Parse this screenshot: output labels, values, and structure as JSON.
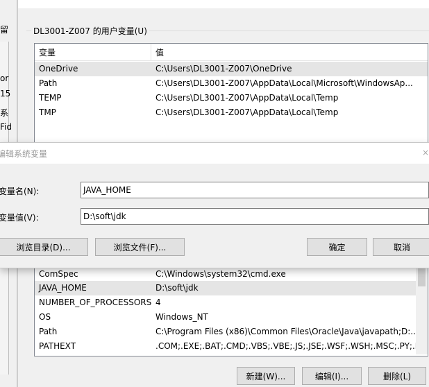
{
  "background_window": {
    "left_text_fragments": [
      "留",
      "or",
      "15",
      "系",
      "Fid"
    ]
  },
  "user_vars": {
    "group_title": "DL3001-Z007 的用户变量(U)",
    "headers": {
      "name": "变量",
      "value": "值"
    },
    "rows": [
      {
        "name": "OneDrive",
        "value": "C:\\Users\\DL3001-Z007\\OneDrive",
        "selected": true
      },
      {
        "name": "Path",
        "value": "C:\\Users\\DL3001-Z007\\AppData\\Local\\Microsoft\\WindowsAp..."
      },
      {
        "name": "TEMP",
        "value": "C:\\Users\\DL3001-Z007\\AppData\\Local\\Temp"
      },
      {
        "name": "TMP",
        "value": "C:\\Users\\DL3001-Z007\\AppData\\Local\\Temp"
      }
    ]
  },
  "edit_dialog": {
    "title": "编辑系统变量",
    "close_glyph": "×",
    "name_label": "变量名(N):",
    "name_value": "JAVA_HOME",
    "value_label": "变量值(V):",
    "value_value": "D:\\soft\\jdk",
    "browse_dir_button": "浏览目录(D)...",
    "browse_file_button": "浏览文件(F)...",
    "ok_button": "确定",
    "cancel_button": "取消"
  },
  "system_vars": {
    "rows": [
      {
        "name": "ComSpec",
        "value": "C:\\Windows\\system32\\cmd.exe"
      },
      {
        "name": "JAVA_HOME",
        "value": "D:\\soft\\jdk",
        "selected": true
      },
      {
        "name": "NUMBER_OF_PROCESSORS",
        "value": "4"
      },
      {
        "name": "OS",
        "value": "Windows_NT"
      },
      {
        "name": "Path",
        "value": "C:\\Program Files (x86)\\Common Files\\Oracle\\Java\\javapath;D:..."
      },
      {
        "name": "PATHEXT",
        "value": ".COM;.EXE;.BAT;.CMD;.VBS;.VBE;.JS;.JSE;.WSF;.WSH;.MSC;.PY;.P..."
      }
    ],
    "buttons": {
      "new": "新建(W)...",
      "edit": "编辑(I)...",
      "delete": "删除(L)"
    }
  }
}
